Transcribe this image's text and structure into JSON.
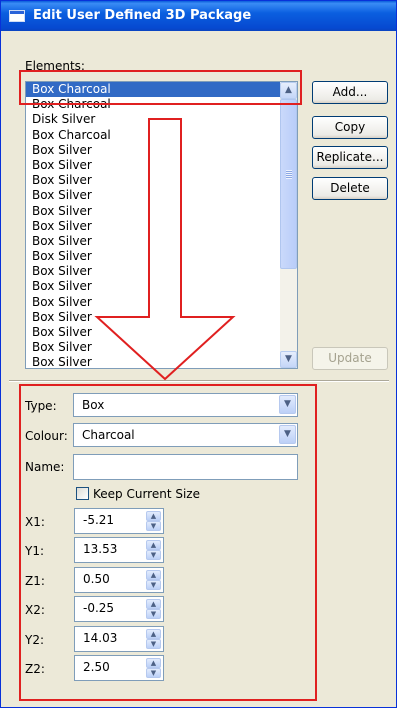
{
  "window": {
    "title": "Edit User Defined 3D Package"
  },
  "elements": {
    "label": "Elements:",
    "items": [
      "Box Charcoal",
      "Box Charcoal",
      "Disk Silver",
      "Box Charcoal",
      "Box Silver",
      "Box Silver",
      "Box Silver",
      "Box Silver",
      "Box Silver",
      "Box Silver",
      "Box Silver",
      "Box Silver",
      "Box Silver",
      "Box Silver",
      "Box Silver",
      "Box Silver",
      "Box Silver",
      "Box Silver",
      "Box Silver"
    ],
    "selected_index": 0
  },
  "buttons": {
    "add": "Add...",
    "copy": "Copy",
    "replicate": "Replicate...",
    "delete": "Delete",
    "update": "Update"
  },
  "props": {
    "type_label": "Type:",
    "type_value": "Box",
    "colour_label": "Colour:",
    "colour_value": "Charcoal",
    "name_label": "Name:",
    "name_value": "",
    "keep_size_label": "Keep Current Size",
    "keep_size_checked": false,
    "coords": [
      {
        "label": "X1:",
        "value": "-5.21"
      },
      {
        "label": "Y1:",
        "value": "13.53"
      },
      {
        "label": "Z1:",
        "value": "0.50"
      },
      {
        "label": "X2:",
        "value": "-0.25"
      },
      {
        "label": "Y2:",
        "value": "14.03"
      },
      {
        "label": "Z2:",
        "value": "2.50"
      }
    ]
  },
  "icons": {
    "scroll_up": "chevron-up-icon",
    "scroll_down": "chevron-down-icon",
    "dropdown": "chevron-down-icon",
    "spin": "spin-arrows-icon",
    "app": "window-icon",
    "annotation_arrow": "down-arrow-icon"
  },
  "colors": {
    "titlebar": "#0a5ddb",
    "selection": "#316ac5",
    "annotation": "#e02020",
    "dialog_bg": "#ece9d8"
  }
}
